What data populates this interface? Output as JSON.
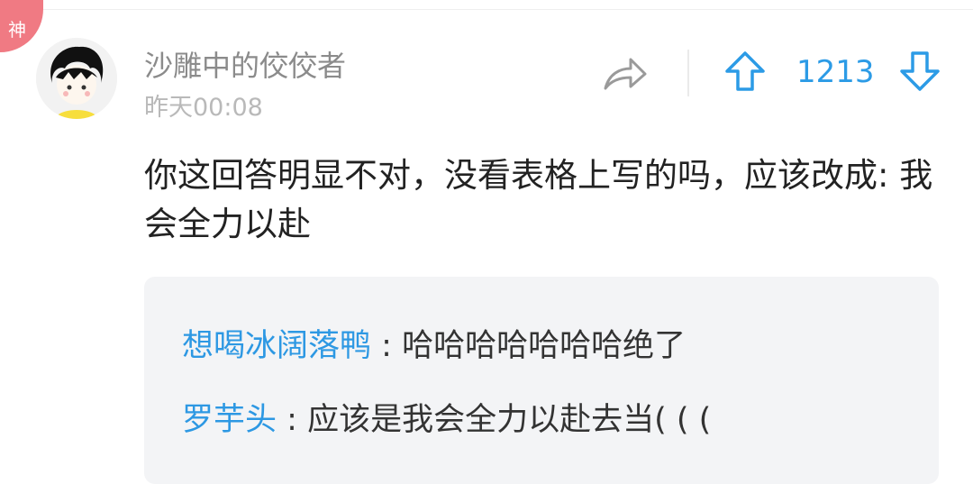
{
  "badge": {
    "label": "神"
  },
  "comment": {
    "username": "沙雕中的佼佼者",
    "time": "昨天00:08",
    "vote_count": "1213",
    "text": "你这回答明显不对，没看表格上写的吗，应该改成: 我会全力以赴"
  },
  "replies": [
    {
      "name": "想喝冰阔落鸭",
      "separator": " : ",
      "text": "哈哈哈哈哈哈哈绝了"
    },
    {
      "name": "罗芋头",
      "separator": " : ",
      "text": "应该是我会全力以赴去当( ( ("
    }
  ],
  "colors": {
    "accent": "#2c9be6",
    "badge": "#f07a83",
    "reply_bg": "#f3f4f6"
  },
  "icons": {
    "share": "share-arrow-icon",
    "upvote": "upvote-arrow-icon",
    "downvote": "downvote-arrow-icon"
  }
}
